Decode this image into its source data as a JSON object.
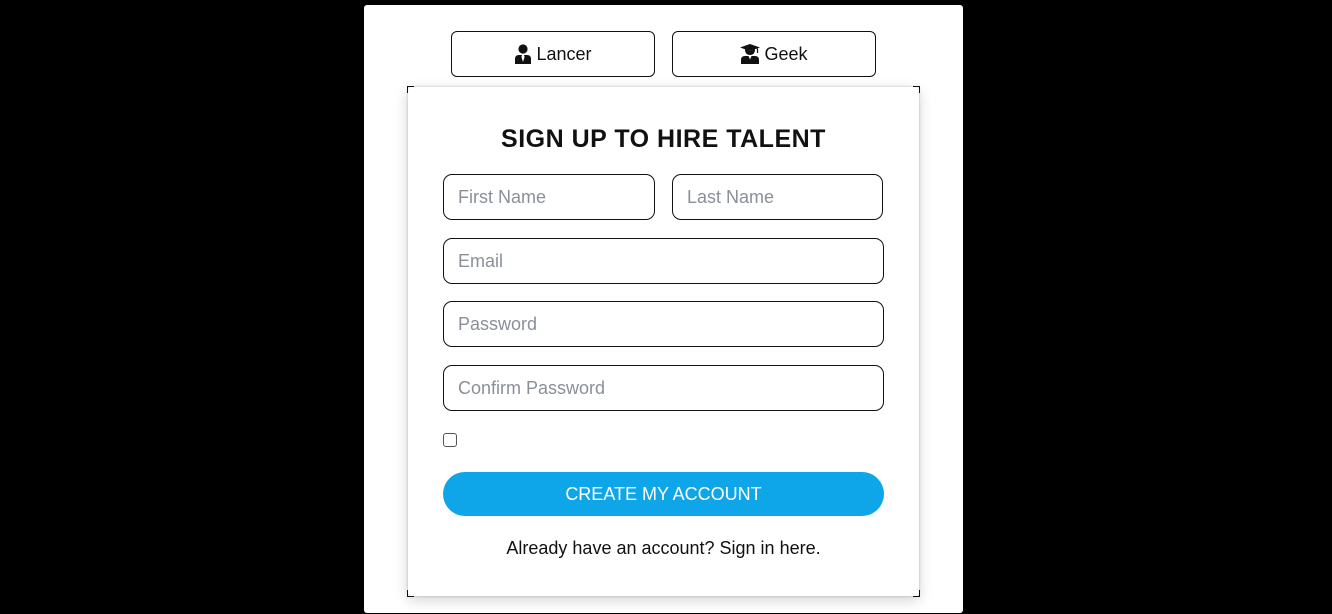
{
  "roles": {
    "lancer": {
      "label": "Lancer",
      "icon": "user-tie-icon"
    },
    "geek": {
      "label": "Geek",
      "icon": "graduate-icon"
    }
  },
  "form": {
    "title": "SIGN UP TO HIRE TALENT",
    "first_name": {
      "placeholder": "First Name",
      "value": ""
    },
    "last_name": {
      "placeholder": "Last Name",
      "value": ""
    },
    "email": {
      "placeholder": "Email",
      "value": ""
    },
    "password": {
      "placeholder": "Password",
      "value": ""
    },
    "confirm_password": {
      "placeholder": "Confirm Password",
      "value": ""
    },
    "terms_checked": false,
    "submit_label": "CREATE MY ACCOUNT",
    "signin_text": "Already have an account? Sign in here."
  },
  "colors": {
    "background": "#000000",
    "accent": "#0ea5e9",
    "card": "#ffffff"
  }
}
